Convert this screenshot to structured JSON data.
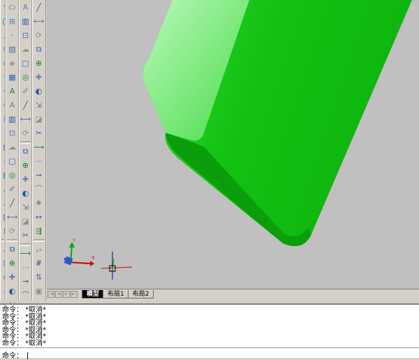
{
  "toolbars": [
    {
      "id": "draw",
      "icons": [
        "line-icon",
        "polyline-icon",
        "circle-icon",
        "polygon-icon",
        "rectangle-icon",
        "arc-icon",
        "spline-icon",
        "ellipse-icon",
        "insert-block-icon",
        "point-icon",
        "hatch-icon",
        "region-icon",
        "table-icon",
        "mtext-icon",
        "text-icon",
        "gradient-icon",
        "boundary-icon",
        "revcloud-icon",
        "wipeout-icon",
        "donut-icon",
        "sketch-icon",
        "xline-icon"
      ]
    },
    {
      "id": "modify",
      "icons": [
        "erase-icon",
        "copy-icon",
        "mirror-icon",
        "offset-icon",
        "array-icon",
        "move-icon",
        "rotate-icon",
        "scale-icon",
        "stretch-icon",
        "trim-icon",
        "extend-icon",
        "break-icon",
        "join-icon",
        "chamfer-icon",
        "fillet-icon",
        "explode-icon",
        "lengthen-icon",
        "align-icon",
        "pedit-icon",
        "multiline-edit-icon",
        "draworder-icon",
        "group-icon",
        "layer-icon"
      ]
    },
    {
      "id": "solids",
      "icons": [
        "polysolid-icon",
        "box-icon",
        "wedge-icon",
        "cone-icon",
        "sphere-icon",
        "cylinder-icon",
        "torus-icon",
        "pyramid-icon",
        "helix-icon",
        "planar-surface-icon",
        "extrude-icon",
        "presspull-icon",
        "sweep-icon",
        "revolve-icon",
        "loft-icon",
        "union-icon",
        "slice-icon",
        "interfere-icon",
        "section-icon",
        "flatshot-icon",
        "visual-style-icon",
        "camera-icon"
      ]
    },
    {
      "id": "solid-edit",
      "icons": [
        "union-icon",
        "subtract-icon",
        "intersect-icon",
        "extrude-faces-icon",
        "move-faces-icon",
        "offset-faces-icon",
        "delete-faces-icon",
        "rotate-faces-icon",
        "taper-faces-icon",
        "copy-faces-icon",
        "color-faces-icon",
        "copy-edges-icon",
        "color-edges-icon",
        "imprint-icon",
        "clean-icon",
        "separate-icon",
        "shell-icon",
        "check-icon",
        "text-style-icon",
        "dim-text-icon",
        "spell-check-icon",
        "find-icon"
      ]
    }
  ],
  "tabs": {
    "model": "模型",
    "layout1": "布局1",
    "layout2": "布局2"
  },
  "ucs": {
    "x": "X",
    "y": "Y"
  },
  "command_history": [
    "命令： *取消*",
    "命令： *取消*",
    "命令： *取消*",
    "命令： *取消*",
    "命令： *取消*",
    "命令： *取消*"
  ],
  "command_prompt": "命令：",
  "colors": {
    "solid": "#10b810",
    "solid_light": "#a0f5a0",
    "solid_dark": "#0a9a0a",
    "viewport": "#c0c0c0"
  }
}
